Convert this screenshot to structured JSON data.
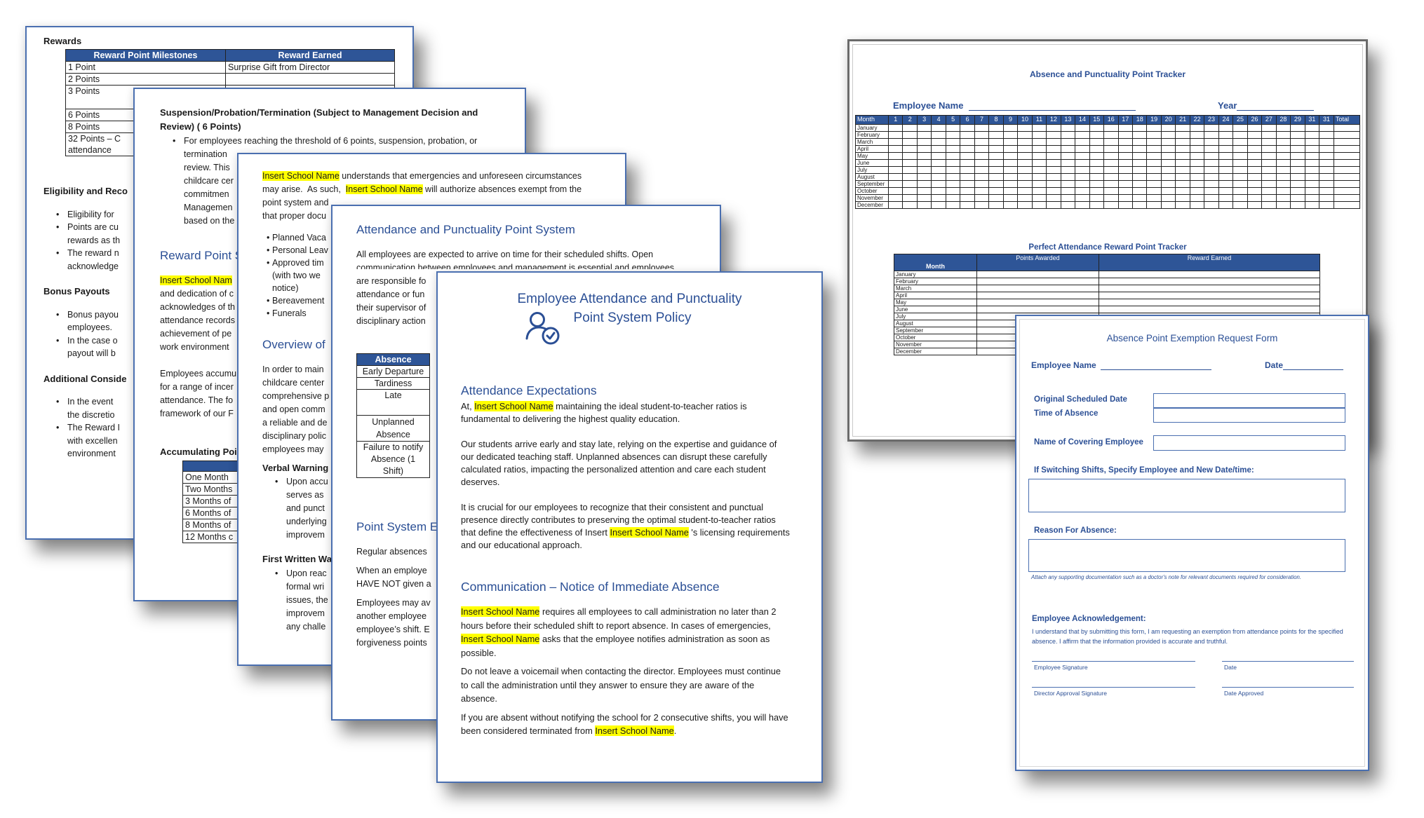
{
  "doc1": {
    "heading": "Rewards",
    "table_headers": [
      "Reward Point Milestones",
      "Reward Earned"
    ],
    "rows": [
      [
        "1 Point",
        "Surprise Gift from Director"
      ],
      [
        "2 Points",
        ""
      ],
      [
        "3 Points",
        ""
      ],
      [
        "6 Points",
        ""
      ],
      [
        "8 Points",
        ""
      ],
      [
        "32 Points – C",
        ""
      ]
    ],
    "row6_line2": "attendance",
    "section_eligibility": "Eligibility and Reco",
    "eligibility_bullets": [
      [
        "Eligibility for"
      ],
      [
        "Points are cu",
        "rewards as th"
      ],
      [
        "The reward n",
        "acknowledge"
      ]
    ],
    "section_bonus": "Bonus Payouts",
    "bonus_bullets": [
      [
        "Bonus payou",
        "employees."
      ],
      [
        "In the case o",
        "payout will b"
      ]
    ],
    "section_additional": "Additional Conside",
    "additional_bullets": [
      [
        "In the event",
        "the discretio"
      ],
      [
        "The Reward I",
        "with excellen",
        "environment"
      ]
    ]
  },
  "doc2": {
    "heading_line1": "Suspension/Probation/Termination (Subject to Management Decision and",
    "heading_line2": "Review) ( 6 Points)",
    "bullet_first": "For employees reaching the threshold of 6 points, suspension, probation, or",
    "bullet_lines": [
      "termination",
      "review. This",
      "childcare cer",
      "commitmen",
      "Managemen",
      "based on the"
    ],
    "section_title": "Reward Point S",
    "para1_highlight": "Insert School Nam",
    "para1_lines": [
      "and dedication of c",
      "acknowledges of th",
      "attendance records",
      "achievement of pe",
      "work environment"
    ],
    "para2_lines": [
      "Employees accumu",
      "for a range of incer",
      "attendance. The fo",
      "framework of our F"
    ],
    "table_title": "Accumulating Poin",
    "table_rows": [
      "One Month",
      "Two Months",
      "3 Months of",
      "6 Months of",
      "8 Months of",
      "12 Months c"
    ]
  },
  "doc3": {
    "line1_highlight": "Insert School Name",
    "line1_rest": " understands that emergencies and unforeseen circumstances",
    "line2_start": "may arise.  As such,  ",
    "line2_highlight": "Insert School Name",
    "line2_rest": " will authorize absences exempt from the",
    "line3": "point system and",
    "line4": "that proper docu",
    "bullets": [
      "Planned Vaca",
      "Personal Leav",
      "Approved tim",
      "Bereavement",
      "Funerals"
    ],
    "bullet3_cont": [
      "(with two we",
      "notice)"
    ],
    "section_title": "Overview of",
    "para_lines": [
      "In order to main",
      "childcare center",
      "comprehensive p",
      "and open comm",
      "a reliable and de",
      "disciplinary polic",
      "employees may"
    ],
    "verbal_title": "Verbal Warning",
    "verbal_lines": [
      "Upon accu",
      "serves as",
      "and punct",
      "underlying",
      "improvem"
    ],
    "written_title": "First Written Wa",
    "written_lines": [
      "Upon reac",
      "formal wri",
      "issues, the",
      "improvem",
      "any challe"
    ]
  },
  "doc4": {
    "title": "Attendance and Punctuality Point System",
    "intro_line1": "All employees are expected to arrive on time for their scheduled shifts.  Open",
    "intro_line2": "communication between employees and management is essential and employees",
    "intro_lines": [
      "are responsible fo",
      "attendance or fun",
      "their supervisor of",
      "disciplinary action"
    ],
    "table_header": "Absence",
    "table_rows": [
      [
        "Early Departure"
      ],
      [
        "Tardiness"
      ],
      [
        "Late",
        ""
      ],
      [
        "Unplanned",
        "Absence"
      ],
      [
        "Failure to notify",
        "Absence (1",
        "Shift)"
      ]
    ],
    "section_title": "Point System E",
    "para_lines": [
      "Regular absences",
      "When an employe",
      "HAVE NOT given a",
      "Employees may av",
      "another employee",
      "employee’s shift. E",
      "forgiveness points"
    ]
  },
  "doc5": {
    "title_line1": "Employee Attendance and Punctuality",
    "title_line2": "Point System Policy",
    "icon": "user-check-icon",
    "section1_title": "Attendance Expectations",
    "p1_start": "At, ",
    "p1_highlight": "Insert School Name",
    "p1_rest": " maintaining the ideal student-to-teacher ratios is fundamental to delivering the highest quality education.",
    "p2": "Our students arrive early and stay late, relying on the expertise and guidance of our dedicated teaching staff. Unplanned absences can disrupt these carefully calculated ratios, impacting the personalized attention and care each student deserves.",
    "p3_start": "It is crucial for our employees to recognize that their consistent and punctual presence directly contributes to preserving the optimal student-to-teacher ratios that define the effectiveness of Insert ",
    "p3_highlight": "Insert School Name",
    "p3_rest": " 's licensing requirements and our educational approach.",
    "section2_title": "Communication – Notice of Immediate Absence",
    "p4_highlight1": "Insert School Name",
    "p4_mid": " requires all employees to call administration no later than 2 hours before their scheduled shift to report absence. In cases of emergencies, ",
    "p4_highlight2": "Insert School Name",
    "p4_rest": " asks that the employee notifies administration as soon as possible.",
    "p5": "Do not leave a voicemail when contacting the director. Employees must continue to call the administration until they answer to ensure they are aware of the absence.",
    "p6_start": "If you are absent without notifying the school for 2 consecutive shifts, you will have been considered terminated from ",
    "p6_highlight": "Insert School Name",
    "p6_end": "."
  },
  "doc6": {
    "title": "Absence and Punctuality Point Tracker",
    "employee_label": "Employee Name",
    "year_label": "Year",
    "grid_headers": [
      "Month",
      "1",
      "2",
      "3",
      "4",
      "5",
      "6",
      "7",
      "8",
      "9",
      "10",
      "11",
      "12",
      "13",
      "14",
      "15",
      "16",
      "17",
      "18",
      "19",
      "20",
      "21",
      "22",
      "23",
      "24",
      "25",
      "26",
      "27",
      "28",
      "29",
      "31",
      "31",
      "Total"
    ],
    "months": [
      "January",
      "February",
      "March",
      "April",
      "May",
      "June",
      "July",
      "August",
      "September",
      "October",
      "November",
      "December"
    ],
    "reward_title": "Perfect Attendance Reward Point Tracker",
    "reward_headers": [
      "Month",
      "Points Awarded",
      "Reward Earned"
    ]
  },
  "doc7": {
    "title": "Absence Point Exemption Request Form",
    "employee_label": "Employee Name",
    "date_label": "Date",
    "original_date_label": "Original Scheduled Date",
    "time_label": "Time of Absence",
    "covering_label": "Name of Covering Employee",
    "switching_label": "If Switching Shifts, Specify Employee and New Date/time:",
    "reason_label": "Reason For Absence:",
    "attach_note": "Attach any supporting documentation such as a doctor's note for relevant documents required for consideration.",
    "ack_title": "Employee Acknowledgement:",
    "ack_text": "I understand that by submitting this form, I am requesting an exemption from attendance points for the specified absence. I affirm that the information provided is accurate and truthful.",
    "sig_employee": "Employee Signature",
    "sig_date": "Date",
    "sig_director": "Director Approval Signature",
    "sig_date_approved": "Date Approved"
  }
}
